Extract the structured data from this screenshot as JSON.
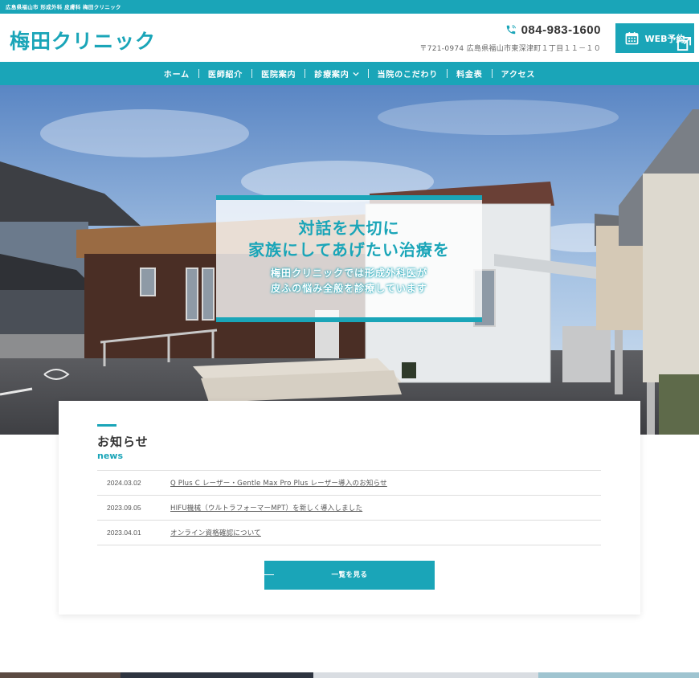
{
  "topbar": {
    "text": "広島県福山市 形成外科 皮膚科 梅田クリニック"
  },
  "header": {
    "logo": "梅田クリニック",
    "phone": "084-983-1600",
    "address": "〒721-0974 広島県福山市東深津町１丁目１１－１０",
    "web_booking_label": "WEB予約"
  },
  "nav": {
    "items": [
      {
        "label": "ホーム"
      },
      {
        "label": "医師紹介"
      },
      {
        "label": "医院案内"
      },
      {
        "label": "診療案内",
        "has_dropdown": true
      },
      {
        "label": "当院のこだわり"
      },
      {
        "label": "料金表"
      },
      {
        "label": "アクセス"
      }
    ]
  },
  "hero": {
    "line1": "対話を大切に",
    "line2": "家族にしてあげたい治療を",
    "sub1": "梅田クリニックでは形成外科医が",
    "sub2": "皮ふの悩み全般を診療しています"
  },
  "news": {
    "title": "お知らせ",
    "subtitle": "news",
    "items": [
      {
        "date": "2024.03.02",
        "text": "Q Plus C レーザー・Gentle Max Pro Plus レーザー導入のお知らせ"
      },
      {
        "date": "2023.09.05",
        "text": "HIFU機械（ウルトラフォーマーMPT）を新しく導入しました"
      },
      {
        "date": "2023.04.01",
        "text": "オンライン資格確認について"
      }
    ],
    "more_label": "一覧を見る"
  },
  "colors": {
    "accent": "#1aa5b8",
    "text": "#333333",
    "background": "#ffffff"
  },
  "icons": {
    "phone": "phone-icon",
    "calendar": "calendar-icon",
    "external": "external-link-icon",
    "dropdown": "chevron-down-icon"
  }
}
